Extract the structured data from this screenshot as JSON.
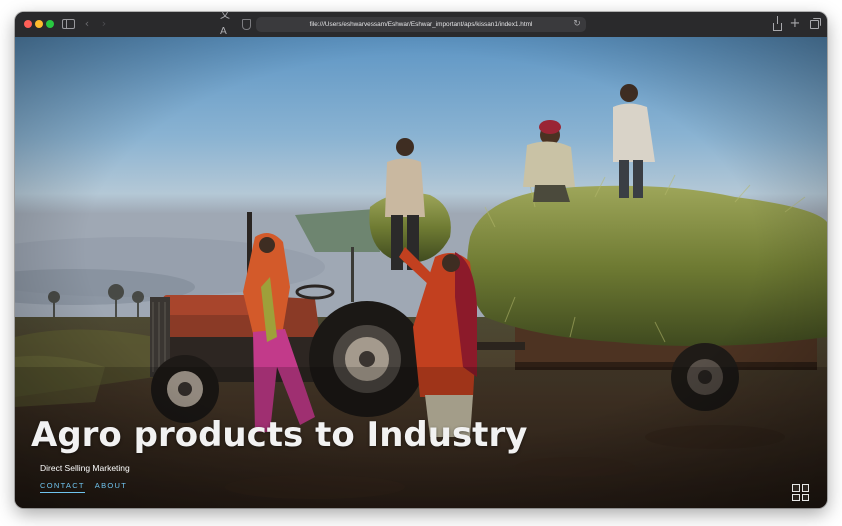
{
  "browser": {
    "url": "file:///Users/eshwarvessam/Eshwar/Eshwar_important/aps/kissan1/index1.html",
    "icons": {
      "sidebar": "sidebar-icon",
      "back": "chevron-left-icon",
      "forward": "chevron-right-icon",
      "translate": "translate-icon",
      "privacy": "shield-icon",
      "reload": "reload-icon",
      "share": "share-icon",
      "new_tab": "plus-icon",
      "tabs": "tab-overview-icon"
    }
  },
  "hero": {
    "title": "Agro products to Industry",
    "subtitle": "Direct Selling Marketing",
    "nav": [
      {
        "label": "CONTACT",
        "active": true
      },
      {
        "label": "ABOUT",
        "active": false
      }
    ],
    "menu_icon": "grid-menu-icon"
  },
  "colors": {
    "title_text": "#f2f2f2",
    "nav_link": "#6fc3ee",
    "traffic_close": "#ff5f57",
    "traffic_minimize": "#febc2e",
    "traffic_maximize": "#28c840"
  }
}
